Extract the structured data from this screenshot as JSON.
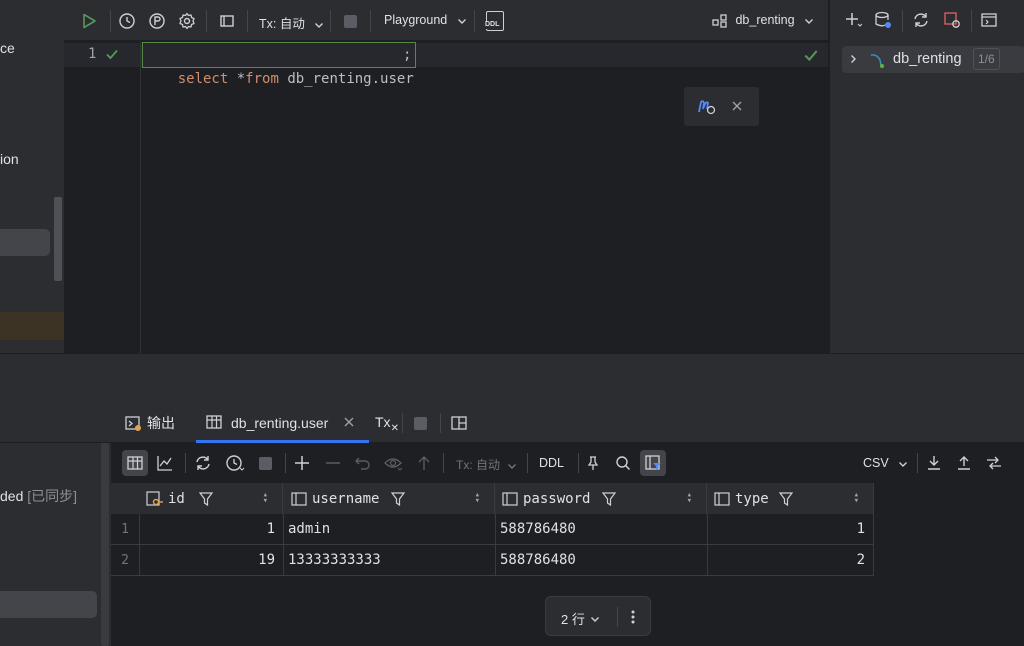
{
  "left_panel": {
    "text_ce": "ce",
    "text_ion": "ion",
    "text_ded": "ded",
    "text_synced": "[已同步]"
  },
  "editor_toolbar": {
    "tx_mode": "Tx: 自动",
    "playground": "Playground",
    "ddl_label": "DDL",
    "datasource": "db_renting"
  },
  "editor": {
    "line_number": "1",
    "query_kw1": "select",
    "query_star": "*",
    "query_kw2": "from",
    "query_rest": "db_renting.user",
    "query_semicolon": ";"
  },
  "db_panel": {
    "item_label": "db_renting",
    "item_count": "1/6"
  },
  "results": {
    "tabs": [
      {
        "label": "输出"
      },
      {
        "label": "db_renting.user"
      }
    ],
    "tx_tab": "Tx",
    "toolbar": {
      "tx_mode": "Tx: 自动",
      "ddl": "DDL",
      "format": "CSV"
    },
    "columns": [
      "id",
      "username",
      "password",
      "type"
    ],
    "rows": [
      {
        "num": "1",
        "id": "1",
        "username": "admin",
        "password": "588786480",
        "type": "1"
      },
      {
        "num": "2",
        "id": "19",
        "username": "13333333333",
        "password": "588786480",
        "type": "2"
      }
    ],
    "row_count": "2 行"
  },
  "colors": {
    "accent_green": "#57965c",
    "select_blue": "#2e436e",
    "keyword": "#cf8e6d"
  }
}
